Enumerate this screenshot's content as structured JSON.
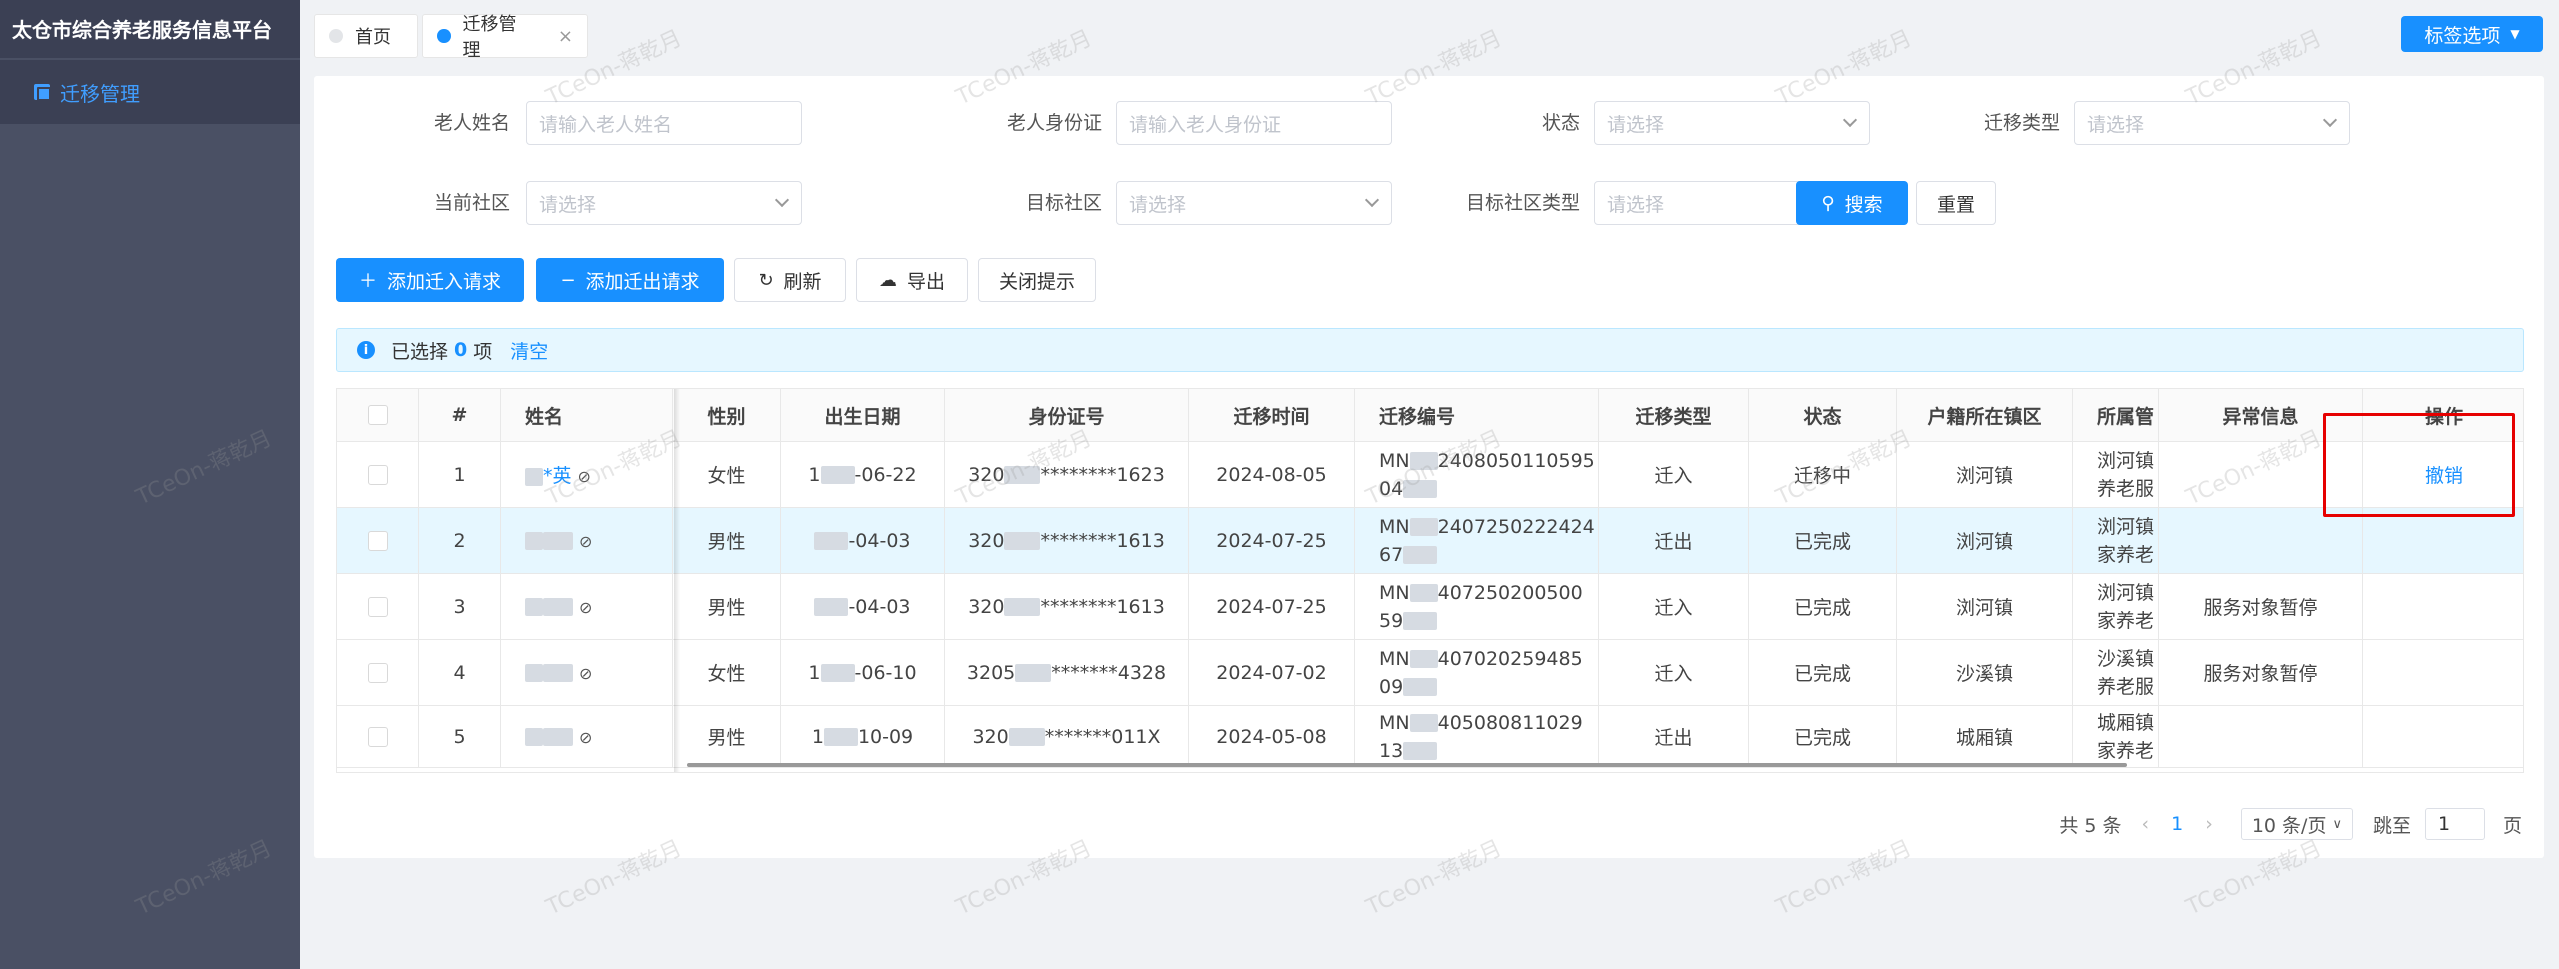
{
  "app": {
    "title": "太仓市综合养老服务信息平台"
  },
  "sidebar": {
    "items": [
      {
        "label": "迁移管理"
      }
    ]
  },
  "tabs": [
    {
      "label": "首页"
    },
    {
      "label": "迁移管理",
      "close": "×"
    }
  ],
  "header": {
    "tag_options": "标签选项"
  },
  "filters": {
    "elder_name": {
      "label": "老人姓名",
      "placeholder": "请输入老人姓名"
    },
    "elder_id": {
      "label": "老人身份证",
      "placeholder": "请输入老人身份证"
    },
    "status": {
      "label": "状态",
      "placeholder": "请选择"
    },
    "migrate_type": {
      "label": "迁移类型",
      "placeholder": "请选择"
    },
    "current_community": {
      "label": "当前社区",
      "placeholder": "请选择"
    },
    "target_community": {
      "label": "目标社区",
      "placeholder": "请选择"
    },
    "target_community_type": {
      "label": "目标社区类型",
      "placeholder": "请选择"
    },
    "search": "搜索",
    "reset": "重置"
  },
  "toolbar": {
    "add_in": "添加迁入请求",
    "add_out": "添加迁出请求",
    "refresh": "刷新",
    "export": "导出",
    "close_tip": "关闭提示"
  },
  "selection": {
    "prefix": "已选择",
    "count": "0",
    "suffix": "项",
    "clear": "清空"
  },
  "table": {
    "columns": [
      "#",
      "姓名",
      "性别",
      "出生日期",
      "身份证号",
      "迁移时间",
      "迁移编号",
      "迁移类型",
      "状态",
      "户籍所在镇区",
      "所属管",
      "异常信息",
      "操作"
    ],
    "rows": [
      {
        "no": "1",
        "name": "*英",
        "gender": "女性",
        "birth": "-06-22",
        "birth_prefix": "1",
        "id_prefix": "320",
        "id_suffix": "********1623",
        "time": "2024-08-05",
        "code1": "MN",
        "code1b": "2408050110595",
        "code2": "04",
        "type": "迁入",
        "status": "迁移中",
        "district": "浏河镇",
        "org1": "浏河镇",
        "org2": "养老服",
        "error": "",
        "op": "撤销"
      },
      {
        "no": "2",
        "name": "",
        "gender": "男性",
        "birth": "-04-03",
        "birth_prefix": "",
        "id_prefix": "320",
        "id_suffix": "********1613",
        "time": "2024-07-25",
        "code1": "MN",
        "code1b": "2407250222424",
        "code2": "67",
        "type": "迁出",
        "status": "已完成",
        "district": "浏河镇",
        "org1": "浏河镇",
        "org2": "家养老",
        "error": "",
        "op": ""
      },
      {
        "no": "3",
        "name": "",
        "gender": "男性",
        "birth": "-04-03",
        "birth_prefix": "",
        "id_prefix": "320",
        "id_suffix": "********1613",
        "time": "2024-07-25",
        "code1": "MN",
        "code1b": "407250200500",
        "code2": "59",
        "type": "迁入",
        "status": "已完成",
        "district": "浏河镇",
        "org1": "浏河镇",
        "org2": "家养老",
        "error": "服务对象暂停",
        "op": ""
      },
      {
        "no": "4",
        "name": "",
        "gender": "女性",
        "birth": "-06-10",
        "birth_prefix": "1",
        "id_prefix": "3205",
        "id_suffix": "*******4328",
        "time": "2024-07-02",
        "code1": "MN",
        "code1b": "407020259485",
        "code2": "09",
        "type": "迁入",
        "status": "已完成",
        "district": "沙溪镇",
        "org1": "沙溪镇",
        "org2": "养老服",
        "error": "服务对象暂停",
        "op": ""
      },
      {
        "no": "5",
        "name": "",
        "gender": "男性",
        "birth": "10-09",
        "birth_prefix": "1",
        "id_prefix": "320",
        "id_suffix": "*******011X",
        "time": "2024-05-08",
        "code1": "MN",
        "code1b": "405080811029",
        "code2": "13",
        "type": "迁出",
        "status": "已完成",
        "district": "城厢镇",
        "org1": "城厢镇",
        "org2": "家养老",
        "error": "",
        "op": ""
      }
    ]
  },
  "pagination": {
    "total": "共 5 条",
    "current": "1",
    "size": "10 条/页",
    "jump_label": "跳至",
    "jump_value": "1",
    "page_suffix": "页"
  },
  "watermark": "TCeOn-蒋乾月"
}
